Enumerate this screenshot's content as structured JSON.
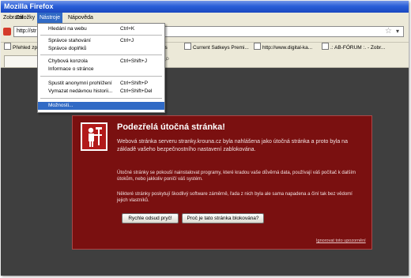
{
  "window": {
    "title": "Mozilla Firefox"
  },
  "menubar": {
    "items": [
      {
        "label": "Zobrazit"
      },
      {
        "label": "Záložky"
      },
      {
        "label": "Nástroje"
      },
      {
        "label": "Nápověda"
      }
    ]
  },
  "urlbar": {
    "value": "http://str"
  },
  "bookmarks": [
    {
      "label": "Přehled zpráv"
    },
    {
      "label": "ikeys"
    },
    {
      "label": "Current Satkeys Premi..."
    },
    {
      "label": "http://www.digital-ka..."
    },
    {
      "label": ".: AB-FÓRUM :. - Zobr..."
    }
  ],
  "tools_menu": {
    "items": [
      {
        "label": "Hledání na webu",
        "shortcut": "Ctrl+K"
      },
      {
        "label": "Správce stahování",
        "shortcut": "Ctrl+J"
      },
      {
        "label": "Správce doplňků",
        "shortcut": ""
      },
      {
        "label": "Chybová konzola",
        "shortcut": "Ctrl+Shift+J"
      },
      {
        "label": "Informace o stránce",
        "shortcut": ""
      },
      {
        "label": "Spustit anonymní prohlížení",
        "shortcut": "Ctrl+Shift+P"
      },
      {
        "label": "Vymazat nedávnou historii...",
        "shortcut": "Ctrl+Shift+Del"
      },
      {
        "label": "Možnosti...",
        "shortcut": ""
      }
    ]
  },
  "warning": {
    "title": "Podezřelá útočná stránka!",
    "paragraph1": "Webová stránka serveru stranky.krouna.cz byla nahlášena jako útočná stránka a proto byla na základě vašeho bezpečnostního nastavení zablokována.",
    "paragraph2": "Útočné stránky se pokouší nainstalovat programy, které kradou vaše důvěrná data, používají váš počítač k dalším útokům, nebo jakkoliv poničí váš systém.",
    "paragraph3": "Některé stránky poskytují škodlivý software záměrně, řada z nich byla ale sama napadena a činí tak bez vědomí jejich vlastníků.",
    "button_back": "Rychle odsud pryč!",
    "button_why": "Proč je tato stránka blokována?",
    "ignore_link": "Ignorovat toto upozornění"
  },
  "colors": {
    "panel_bg": "#7a1010",
    "page_bg": "#3f3f3f",
    "menu_highlight": "#316ac5"
  }
}
